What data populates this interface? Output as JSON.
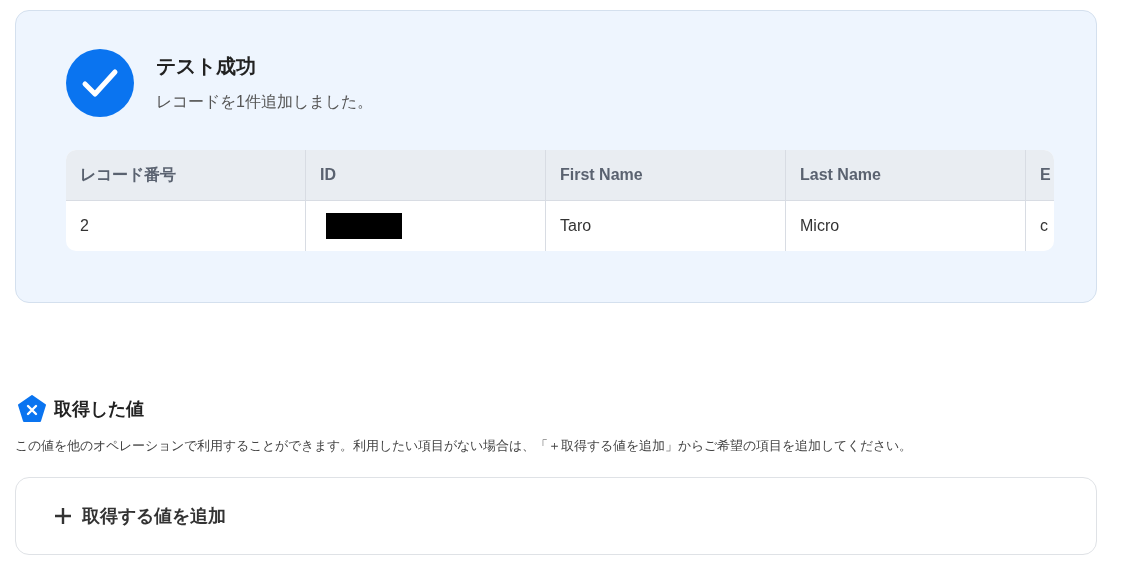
{
  "result": {
    "title": "テスト成功",
    "message": "レコードを1件追加しました。",
    "table": {
      "columns": [
        "レコード番号",
        "ID",
        "First Name",
        "Last Name",
        "E"
      ],
      "rows": [
        {
          "cells": [
            {
              "kind": "text",
              "text": "2"
            },
            {
              "kind": "redacted"
            },
            {
              "kind": "text",
              "text": "Taro"
            },
            {
              "kind": "text",
              "text": "Micro"
            },
            {
              "kind": "text",
              "text": "c"
            }
          ]
        }
      ]
    }
  },
  "values_section": {
    "title": "取得した値",
    "description": "この値を他のオペレーションで利用することができます。利用したい項目がない場合は、「＋取得する値を追加」からご希望の項目を追加してください。",
    "add_button": "取得する値を追加"
  }
}
